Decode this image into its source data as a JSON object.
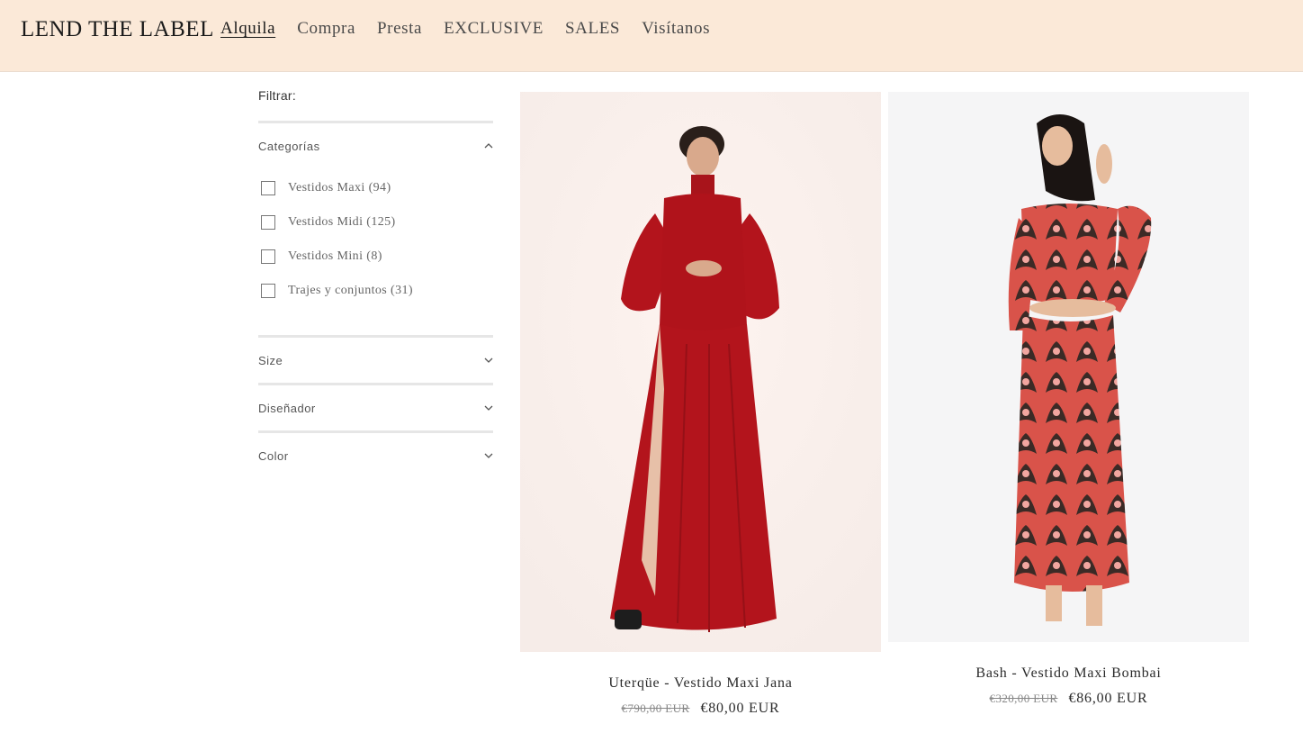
{
  "header": {
    "logo": "LEND THE LABEL",
    "nav": [
      "Alquila",
      "Compra",
      "Presta",
      "EXCLUSIVE",
      "SALES",
      "Visítanos"
    ]
  },
  "filters": {
    "label": "Filtrar:",
    "categories": {
      "title": "Categorías",
      "options": [
        "Vestidos Maxi (94)",
        "Vestidos Midi (125)",
        "Vestidos Mini (8)",
        "Trajes y conjuntos (31)"
      ]
    },
    "size": {
      "title": "Size"
    },
    "designer": {
      "title": "Diseñador"
    },
    "color": {
      "title": "Color"
    }
  },
  "products": [
    {
      "title": "Uterqüe - Vestido Maxi Jana",
      "old_price": "€790,00 EUR",
      "price": "€80,00 EUR"
    },
    {
      "title": "Bash - Vestido Maxi Bombai",
      "old_price": "€320,00 EUR",
      "price": "€86,00 EUR"
    }
  ],
  "colors": {
    "header_bg": "#fbe9d8",
    "dress_red": "#b3141c",
    "dress_print": "#d9534a"
  }
}
